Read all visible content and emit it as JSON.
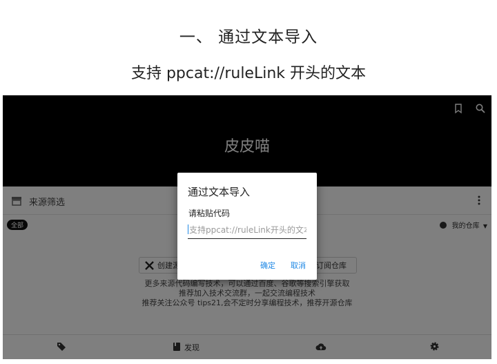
{
  "heading": {
    "line1": "一、  通过文本导入",
    "line2": "支持 ppcat://ruleLink 开头的文本"
  },
  "app": {
    "title": "皮皮喵",
    "appbar_icons": [
      "bookmark-icon",
      "search-icon"
    ]
  },
  "filter": {
    "label": "来源筛选",
    "chip": "全部",
    "repo_label": "我的仓库"
  },
  "actions": {
    "create_label": "创建源",
    "subscribe_label": "订阅仓库"
  },
  "info_lines": [
    "更多来源代码编写技术，可以通过百度、谷歌等搜索引擎获取",
    "推荐加入技术交流群，一起交流编程技术",
    "推荐关注公众号 tips21,会不定时分享编程技术，推荐开源仓库"
  ],
  "bottom_nav": {
    "discover_label": "发现"
  },
  "dialog": {
    "title": "通过文本导入",
    "label": "请粘贴代码",
    "input_value": "",
    "input_placeholder": "支持ppcat://ruleLink开头的文本",
    "confirm_label": "确定",
    "cancel_label": "取消"
  },
  "colors": {
    "accent": "#1e88e5",
    "appbar": "#000000",
    "overlay": "rgba(0,0,0,0.5)"
  }
}
